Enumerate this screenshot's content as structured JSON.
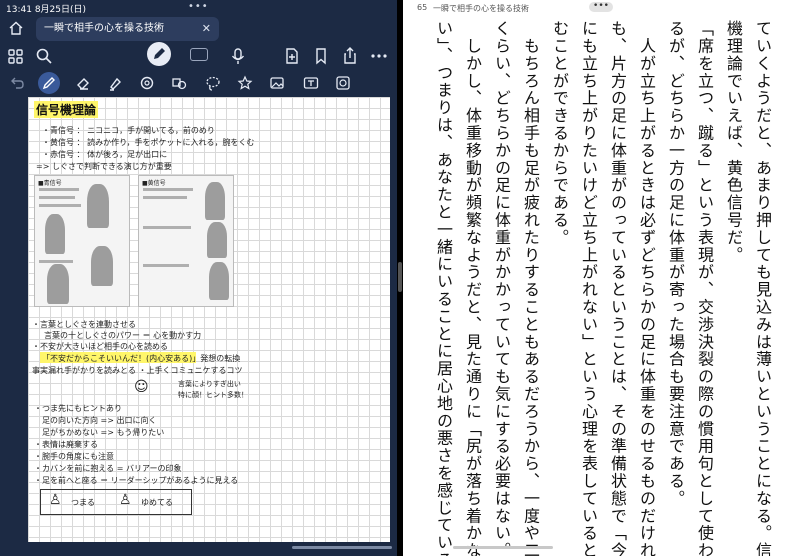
{
  "status": {
    "time": "13:41",
    "date": "8月25日(日)",
    "grabber": "•••"
  },
  "tab": {
    "title": "一瞬で相手の心を操る技術",
    "close": "✕"
  },
  "note": {
    "heading": "信号機理論",
    "lines": [
      "・青信号 ： ニコニコ，手が開いてる，前のめり",
      "・黄信号 ： 読みか作り，手をポケットに入れる，腕をくむ",
      "・赤信号 ： 体が後ろ，足が出口に",
      "=> しぐさで判断できる演じ方が重要"
    ],
    "slide_left_caption": "■青信号",
    "slide_right_caption": "■黄信号",
    "lines2": [
      "・言葉としぐさを連動させる",
      "言葉の十としぐさのパワー ＝ 心を動かす力",
      "・不安が大きいほど相手の心を読める",
      "「不安だからこそいいんだ！(内心安ある)」発想の転換",
      "事実漏れ手がかりを読みとる ・上手くコミュニケするコツ",
      "言葉によりすぎ出い",
      "特に顔！ヒント多数！"
    ],
    "lines3": [
      "・つま先にもヒントあり",
      "足の向いた方向 => 出口に向く",
      "足がちかめない => もう帰りたい",
      "・表情は廃棄する",
      "・腕手の角度にも注意",
      "・カバンを前に抱える = バリアーの印象",
      "・足を前へと座る ＝ リーダーシップがあるように見える"
    ],
    "box_left": "つまる",
    "box_right": "ゆめてる"
  },
  "reader": {
    "page_number": "65",
    "book_title": "一瞬で相手の心を操る技術",
    "menu": "•••",
    "columns": [
      "ていくようだと、あまり押しても見込みは薄いということになる。信号",
      "機理論でいえば、黄色信号だ。",
      "「席を立つ、蹴る」という表現が、交渉決裂の際の慣用句として使われ",
      "るが、どちらか一方の足に体重が寄った場合も要注意である。",
      "　人が立ち上がるときは必ずどちらかの足に体重をのせるものだけれど",
      "も、片方の足に体重がのっているということは、その準備状態で「今",
      "にも立ち上がりたいけど立ち上がれない」という心理を表していると読",
      "むことができるからである。",
      "　もちろん相手も足が疲れたりすることもあるだろうから、一度や二度",
      "くらい、どちらかの足に体重がかかっていても気にする必要はない。",
      "　しかし、体重移動が頻繁なようだと、見た通りに「尻が落ち着かな",
      "い」、つまりは、あなたと一緒にいることに居心地の悪さを感じている"
    ]
  },
  "colors": {
    "toolbar_bg": "#1c2a44",
    "accent": "#3a5a9a",
    "highlight": "#fff66a"
  },
  "icons": [
    "home-icon",
    "grid-icon",
    "search-icon",
    "pencil-icon",
    "keyboard-icon",
    "mic-icon",
    "add-page-icon",
    "bookmark-icon",
    "share-icon",
    "more-icon",
    "undo-icon",
    "pen-icon",
    "eraser-icon",
    "highlighter-icon",
    "shape-icon",
    "lasso-icon",
    "sticker-icon",
    "image-icon",
    "text-icon",
    "camera-icon"
  ]
}
